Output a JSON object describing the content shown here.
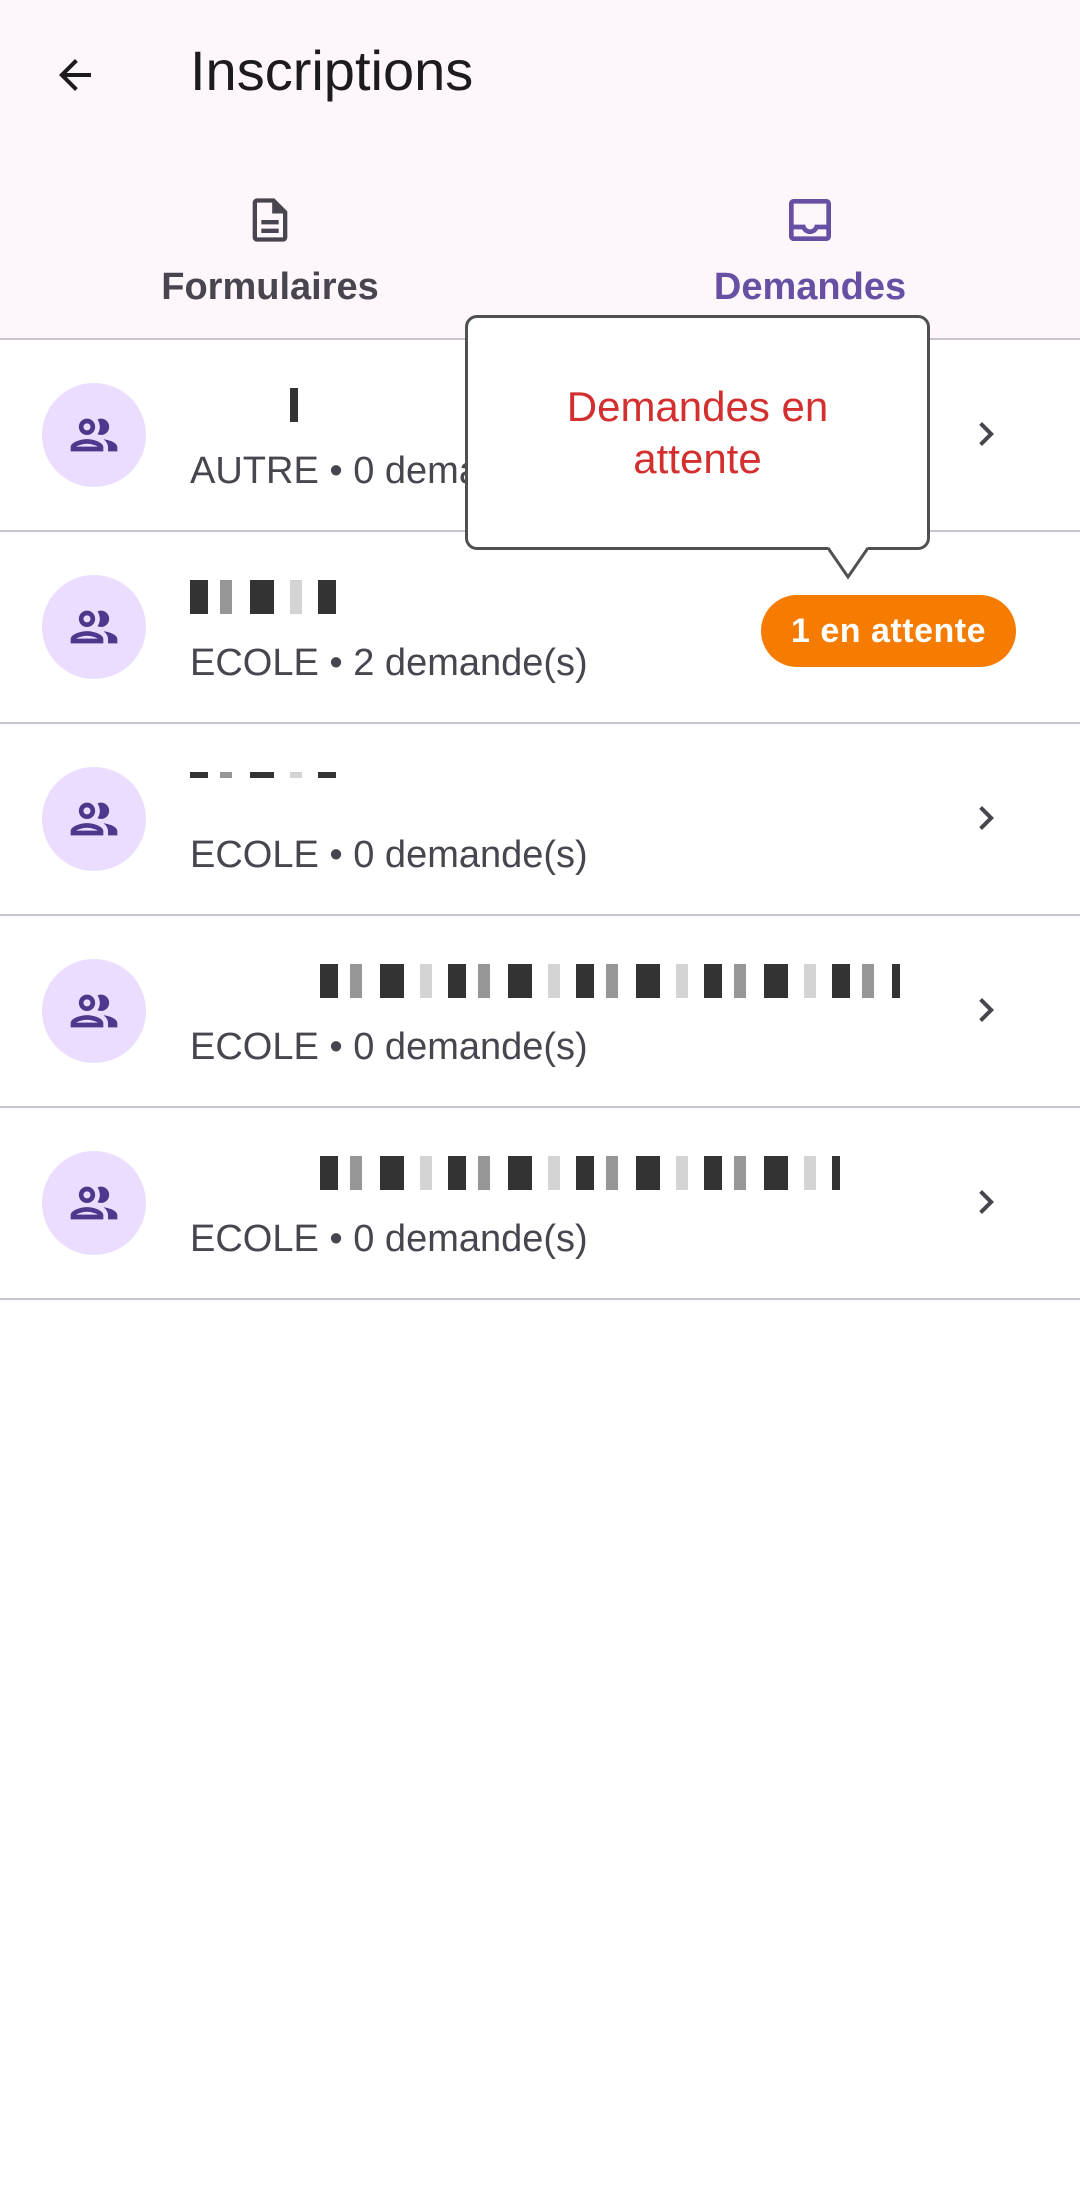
{
  "header": {
    "title": "Inscriptions"
  },
  "tabs": [
    {
      "label": "Formulaires",
      "icon": "document-icon",
      "selected": false
    },
    {
      "label": "Demandes",
      "icon": "inbox-icon",
      "selected": true
    }
  ],
  "colors": {
    "primary": "#6750a4",
    "badge": "#f57c00",
    "tooltip_text": "#d32f2f",
    "avatar_bg": "#eaddff"
  },
  "rows": [
    {
      "subtitle": "AUTRE • 0 demande(s)",
      "badge": null
    },
    {
      "subtitle": "ECOLE • 2 demande(s)",
      "badge": "1 en attente"
    },
    {
      "subtitle": "ECOLE • 0 demande(s)",
      "badge": null
    },
    {
      "subtitle": "ECOLE • 0 demande(s)",
      "badge": null
    },
    {
      "subtitle": "ECOLE • 0 demande(s)",
      "badge": null
    }
  ],
  "tooltip": {
    "text": "Demandes en attente"
  }
}
